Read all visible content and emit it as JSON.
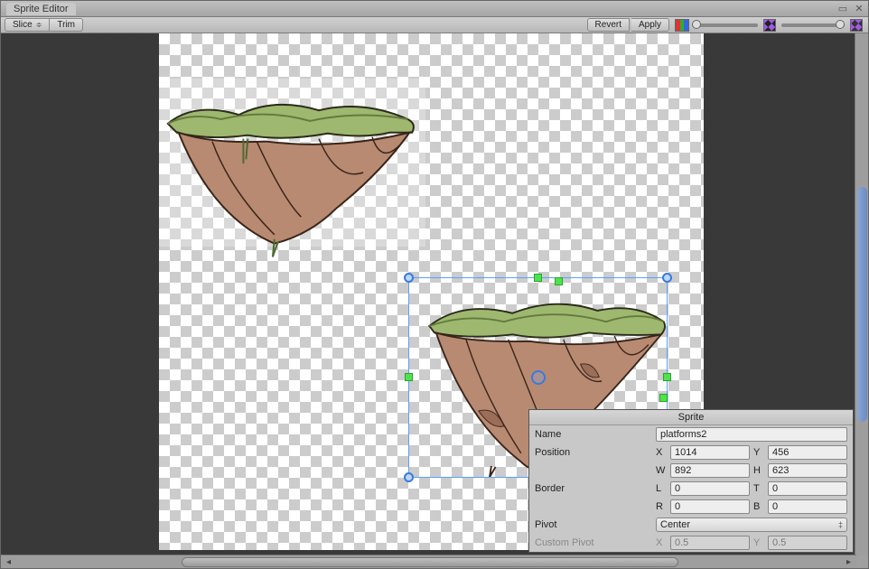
{
  "window": {
    "title": "Sprite Editor"
  },
  "toolbar": {
    "slice": "Slice",
    "trim": "Trim",
    "revert": "Revert",
    "apply": "Apply"
  },
  "inspector": {
    "header": "Sprite",
    "name_label": "Name",
    "name_value": "platforms2",
    "position_label": "Position",
    "position": {
      "X": "1014",
      "Y": "456",
      "W": "892",
      "H": "623"
    },
    "border_label": "Border",
    "border": {
      "L": "0",
      "T": "0",
      "R": "0",
      "B": "0"
    },
    "pivot_label": "Pivot",
    "pivot_value": "Center",
    "custom_pivot_label": "Custom Pivot",
    "custom_pivot": {
      "X": "0.5",
      "Y": "0.5"
    }
  }
}
